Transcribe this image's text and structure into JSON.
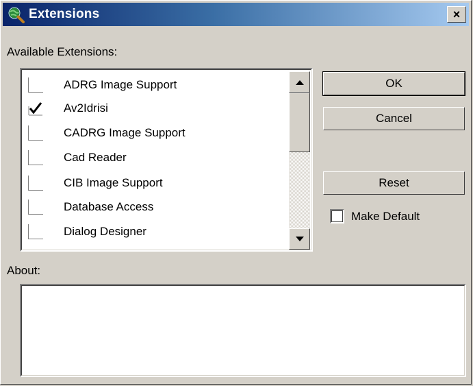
{
  "window": {
    "title": "Extensions",
    "close_label": "×"
  },
  "available_label": "Available Extensions:",
  "extensions": [
    {
      "label": "ADRG Image Support",
      "checked": false
    },
    {
      "label": "Av2Idrisi",
      "checked": true
    },
    {
      "label": "CADRG Image Support",
      "checked": false
    },
    {
      "label": "Cad Reader",
      "checked": false
    },
    {
      "label": "CIB Image Support",
      "checked": false
    },
    {
      "label": "Database Access",
      "checked": false
    },
    {
      "label": "Dialog Designer",
      "checked": false
    }
  ],
  "buttons": {
    "ok": "OK",
    "cancel": "Cancel",
    "reset": "Reset"
  },
  "make_default": {
    "label": "Make Default",
    "checked": false
  },
  "about_label": "About:",
  "about_text": "",
  "colors": {
    "face": "#d4d0c8",
    "title_start": "#0a246a",
    "title_end": "#a6caf0"
  },
  "icons": {
    "title": "globe-magnifier-icon",
    "scroll_up": "arrow-up-icon",
    "scroll_down": "arrow-down-icon",
    "checked": "checkmark-icon"
  }
}
